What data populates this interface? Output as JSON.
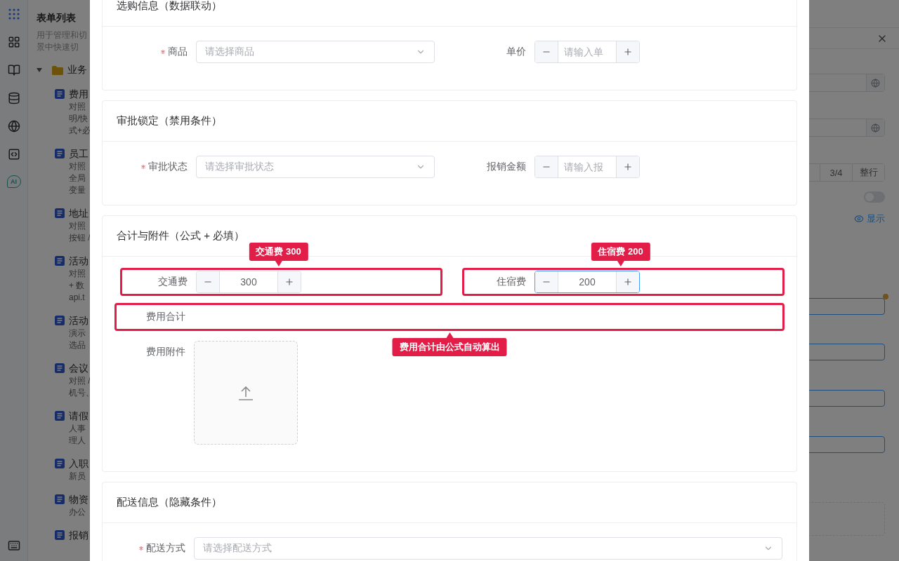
{
  "rail": {
    "ai_label": "AI"
  },
  "sidebar": {
    "title": "表单列表",
    "description": [
      "用于管理和切",
      "景中快速切"
    ],
    "folder": {
      "label": "业务",
      "expanded": true
    },
    "items": [
      {
        "title": "费用",
        "lines": [
          "对照",
          "明/快",
          "式+必"
        ]
      },
      {
        "title": "员工",
        "lines": [
          "对照",
          "全局",
          "变量"
        ]
      },
      {
        "title": "地址",
        "lines": [
          "对照",
          "按钮 /"
        ]
      },
      {
        "title": "活动",
        "lines": [
          "对照",
          "+ 数",
          "api.t"
        ]
      },
      {
        "title": "活动",
        "lines": [
          "演示",
          "选品"
        ]
      },
      {
        "title": "会议",
        "lines": [
          "对照 /",
          "机号、"
        ]
      },
      {
        "title": "请假",
        "lines": [
          "人事",
          "理人"
        ]
      },
      {
        "title": "入职",
        "lines": [
          "新员"
        ]
      },
      {
        "title": "物资",
        "lines": [
          "办公"
        ]
      },
      {
        "title": "报销"
      }
    ]
  },
  "right_panel": {
    "segments": [
      "3/4",
      "整行"
    ],
    "toggle": {
      "on": false
    },
    "visibility_link": "显示"
  },
  "modal": {
    "sections": [
      {
        "title": "选购信息（数据联动）",
        "rows": [
          [
            {
              "kind": "select",
              "label": "商品",
              "required": true,
              "placeholder": "请选择商品",
              "highlighted": false
            },
            {
              "kind": "number",
              "label": "单价",
              "required": false,
              "placeholder": "请输入单",
              "focused": false,
              "highlighted": false
            }
          ]
        ]
      },
      {
        "title": "审批锁定（禁用条件）",
        "rows": [
          [
            {
              "kind": "select",
              "label": "审批状态",
              "required": true,
              "placeholder": "请选择审批状态",
              "highlighted": false
            },
            {
              "kind": "number",
              "label": "报销金额",
              "required": false,
              "placeholder": "请输入报",
              "focused": false,
              "highlighted": false
            }
          ]
        ]
      },
      {
        "title": "合计与附件（公式 + 必填）",
        "rows": [
          [
            {
              "kind": "number",
              "label": "交通费",
              "required": false,
              "value": "300",
              "focused": false,
              "highlighted": true,
              "callout_above": "交通费 300"
            },
            {
              "kind": "number",
              "label": "住宿费",
              "required": false,
              "value": "200",
              "focused": true,
              "highlighted": true,
              "callout_above": "住宿费 200"
            }
          ],
          [
            {
              "kind": "formula",
              "label": "费用合计",
              "required": false,
              "highlighted": true,
              "callout_below": "费用合计由公式自动算出"
            }
          ],
          [
            {
              "kind": "upload",
              "label": "费用附件",
              "required": false,
              "highlighted": false
            }
          ]
        ]
      },
      {
        "title": "配送信息（隐藏条件）",
        "rows": [
          [
            {
              "kind": "select",
              "label": "配送方式",
              "required": true,
              "placeholder": "请选择配送方式",
              "highlighted": false
            }
          ]
        ]
      }
    ]
  }
}
